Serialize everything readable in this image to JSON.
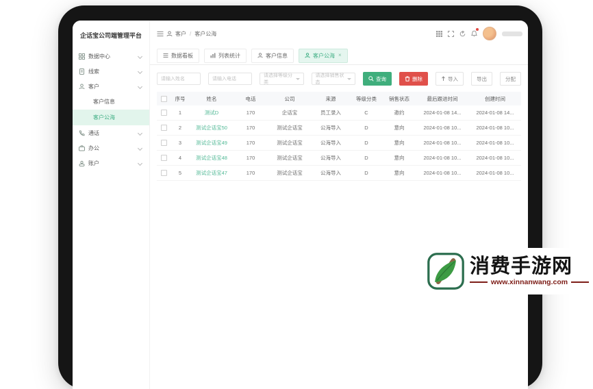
{
  "app": {
    "title": "企话宝公司端管理平台",
    "sidebar": {
      "items": [
        {
          "label": "数据中心",
          "icon": "grid-icon"
        },
        {
          "label": "线索",
          "icon": "document-icon"
        },
        {
          "label": "客户",
          "icon": "customer-icon",
          "expanded": true
        },
        {
          "label": "客户信息",
          "sub": true
        },
        {
          "label": "客户公海",
          "sub": true,
          "active": true
        },
        {
          "label": "通话",
          "icon": "phone-icon"
        },
        {
          "label": "办公",
          "icon": "office-icon"
        },
        {
          "label": "账户",
          "icon": "account-icon"
        }
      ]
    },
    "topbar": {
      "breadcrumb": {
        "root": "客户",
        "separator": "/",
        "current": "客户公海"
      },
      "icons": [
        "menu-grid-icon",
        "fullscreen-icon",
        "refresh-icon",
        "bell-icon"
      ],
      "has_notification_dot": true
    },
    "tabs": [
      {
        "label": "数据看板",
        "icon": "dashboard-icon"
      },
      {
        "label": "列表统计",
        "icon": "stats-icon"
      },
      {
        "label": "客户信息",
        "icon": "customer-icon"
      },
      {
        "label": "客户公海",
        "icon": "pool-icon",
        "active": true,
        "close": "×"
      }
    ],
    "filterbar": {
      "inputs": [
        {
          "placeholder": "请输入姓名"
        },
        {
          "placeholder": "请输入电话"
        }
      ],
      "selects": [
        {
          "placeholder": "请选择等级分类"
        },
        {
          "placeholder": "请选择销售状态"
        }
      ],
      "buttons": {
        "search": "查询",
        "delete": "删除",
        "import": "导入",
        "export": "导出",
        "assign": "分配"
      }
    },
    "table": {
      "headers": [
        "序号",
        "姓名",
        "电话",
        "公司",
        "来源",
        "等级分类",
        "销售状态",
        "最后跟进时间",
        "创建时间"
      ],
      "rows": [
        {
          "no": "1",
          "name": "测试D",
          "phone": "170",
          "company": "企话宝",
          "source": "员工录入",
          "grade": "C",
          "status": "邀约",
          "last_follow": "2024-01-08 14...",
          "created": "2024-01-08 14..."
        },
        {
          "no": "2",
          "name": "测试企话宝50",
          "phone": "170",
          "company": "测试企话宝",
          "source": "公海导入",
          "grade": "D",
          "status": "意向",
          "last_follow": "2024-01-08 10...",
          "created": "2024-01-08 10..."
        },
        {
          "no": "3",
          "name": "测试企话宝49",
          "phone": "170",
          "company": "测试企话宝",
          "source": "公海导入",
          "grade": "D",
          "status": "意向",
          "last_follow": "2024-01-08 10...",
          "created": "2024-01-08 10..."
        },
        {
          "no": "4",
          "name": "测试企话宝48",
          "phone": "170",
          "company": "测试企话宝",
          "source": "公海导入",
          "grade": "D",
          "status": "意向",
          "last_follow": "2024-01-08 10...",
          "created": "2024-01-08 10..."
        },
        {
          "no": "5",
          "name": "测试企话宝47",
          "phone": "170",
          "company": "测试企话宝",
          "source": "公海导入",
          "grade": "D",
          "status": "意向",
          "last_follow": "2024-01-08 10...",
          "created": "2024-01-08 10..."
        }
      ]
    }
  },
  "watermark": {
    "site_name": "消费手游网",
    "site_url": "www.xinnanwang.com"
  },
  "colors": {
    "accent_green": "#3fae7c",
    "danger_red": "#e0504a",
    "active_tab_bg": "#e5f6ef",
    "sidebar_active_bg": "#e2f5ec",
    "table_header_bg": "#f7f8fa",
    "link_green": "#52b996",
    "watermark_red": "#7d1d17",
    "frame_black": "#151515"
  }
}
